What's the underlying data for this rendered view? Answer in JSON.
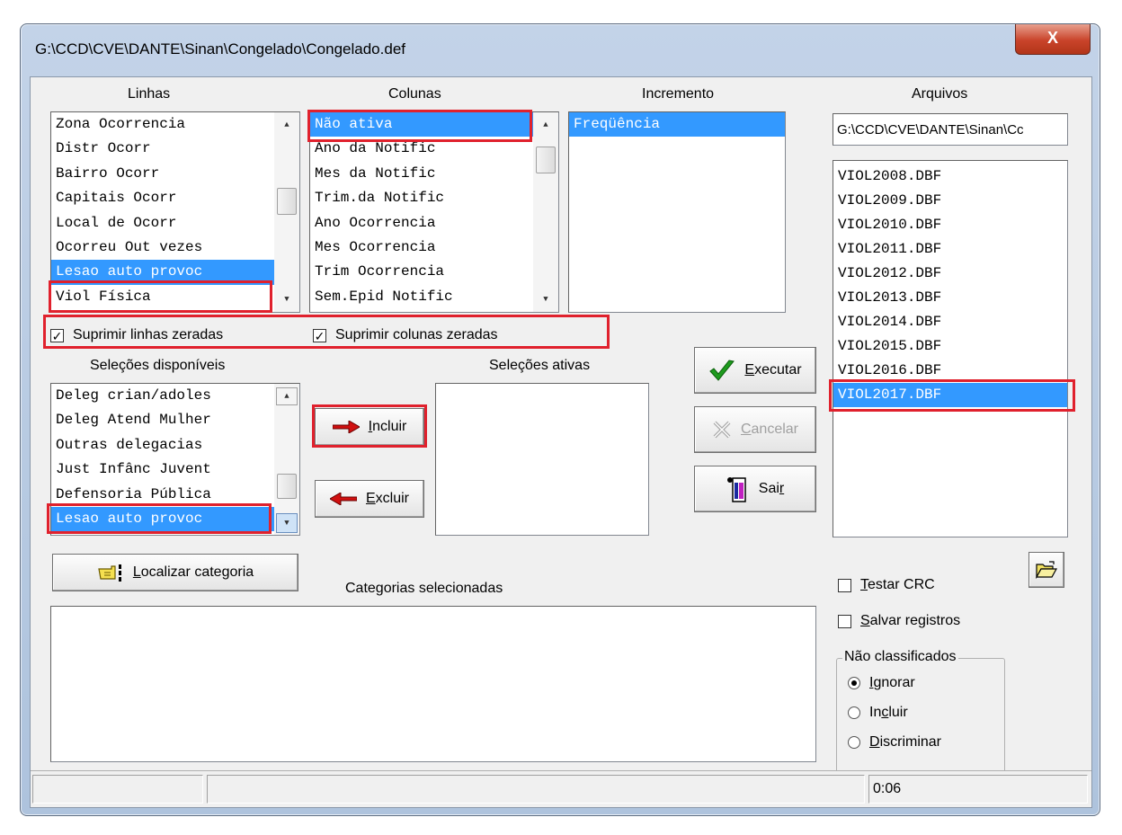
{
  "window": {
    "title": "G:\\CCD\\CVE\\DANTE\\Sinan\\Congelado\\Congelado.def",
    "close_label": "X"
  },
  "headers": {
    "linhas": "Linhas",
    "colunas": "Colunas",
    "incremento": "Incremento",
    "arquivos": "Arquivos",
    "selecoes_disponiveis": "Seleções disponíveis",
    "selecoes_ativas": "Seleções ativas",
    "categorias_selecionadas": "Categorias selecionadas"
  },
  "linhas": [
    "Zona Ocorrencia",
    "Distr Ocorr",
    "Bairro Ocorr",
    "Capitais Ocorr",
    "Local de Ocorr",
    "Ocorreu Out vezes",
    "Lesao auto provoc",
    "Viol Física"
  ],
  "linhas_selected": "Lesao auto provoc",
  "colunas": [
    "Não ativa",
    "Ano da Notific",
    "Mes da Notific",
    "Trim.da Notific",
    "Ano Ocorrencia",
    "Mes Ocorrencia",
    "Trim Ocorrencia",
    "Sem.Epid Notific"
  ],
  "colunas_selected": "Não ativa",
  "incremento": [
    "Freqüência"
  ],
  "arquivos_path": "G:\\CCD\\CVE\\DANTE\\Sinan\\Cc",
  "arquivos": [
    "VIOL2008.DBF",
    "VIOL2009.DBF",
    "VIOL2010.DBF",
    "VIOL2011.DBF",
    "VIOL2012.DBF",
    "VIOL2013.DBF",
    "VIOL2014.DBF",
    "VIOL2015.DBF",
    "VIOL2016.DBF",
    "VIOL2017.DBF"
  ],
  "arquivos_selected": "VIOL2017.DBF",
  "selecoes_disponiveis": [
    "Deleg crian/adoles",
    "Deleg Atend Mulher",
    "Outras delegacias",
    "Just Infânc Juvent",
    "Defensoria Pública",
    "Lesao auto provoc"
  ],
  "selecoes_selected": "Lesao auto provoc",
  "checkboxes": {
    "suprimir_linhas": {
      "label": "Suprimir linhas zeradas",
      "checked": true
    },
    "suprimir_colunas": {
      "label": "Suprimir colunas zeradas",
      "checked": true
    },
    "testar_crc": {
      "label_pre": "",
      "label_u": "T",
      "label_post": "estar CRC",
      "checked": false
    },
    "salvar_registros": {
      "label_pre": "",
      "label_u": "S",
      "label_post": "alvar registros",
      "checked": false
    }
  },
  "buttons": {
    "incluir": {
      "pre": "",
      "u": "I",
      "post": "ncluir"
    },
    "excluir": {
      "pre": "",
      "u": "E",
      "post": "xcluir"
    },
    "executar": {
      "pre": "",
      "u": "E",
      "post": "xecutar"
    },
    "cancelar": {
      "pre": "",
      "u": "C",
      "post": "ancelar"
    },
    "sair": {
      "pre": "Sai",
      "u": "r",
      "post": ""
    },
    "localizar": {
      "pre": "",
      "u": "L",
      "post": "ocalizar categoria"
    }
  },
  "nao_classificados": {
    "title": "Não classificados",
    "options": [
      {
        "pre": "",
        "u": "I",
        "post": "gnorar",
        "selected": true
      },
      {
        "pre": "In",
        "u": "c",
        "post": "luir",
        "selected": false
      },
      {
        "pre": "",
        "u": "D",
        "post": "iscriminar",
        "selected": false
      }
    ]
  },
  "status": {
    "time": "0:06"
  },
  "colors": {
    "selection": "#3399ff",
    "highlight_box": "#e0212d",
    "execute_check": "#1e9b1e",
    "arrow_red": "#d01010"
  }
}
